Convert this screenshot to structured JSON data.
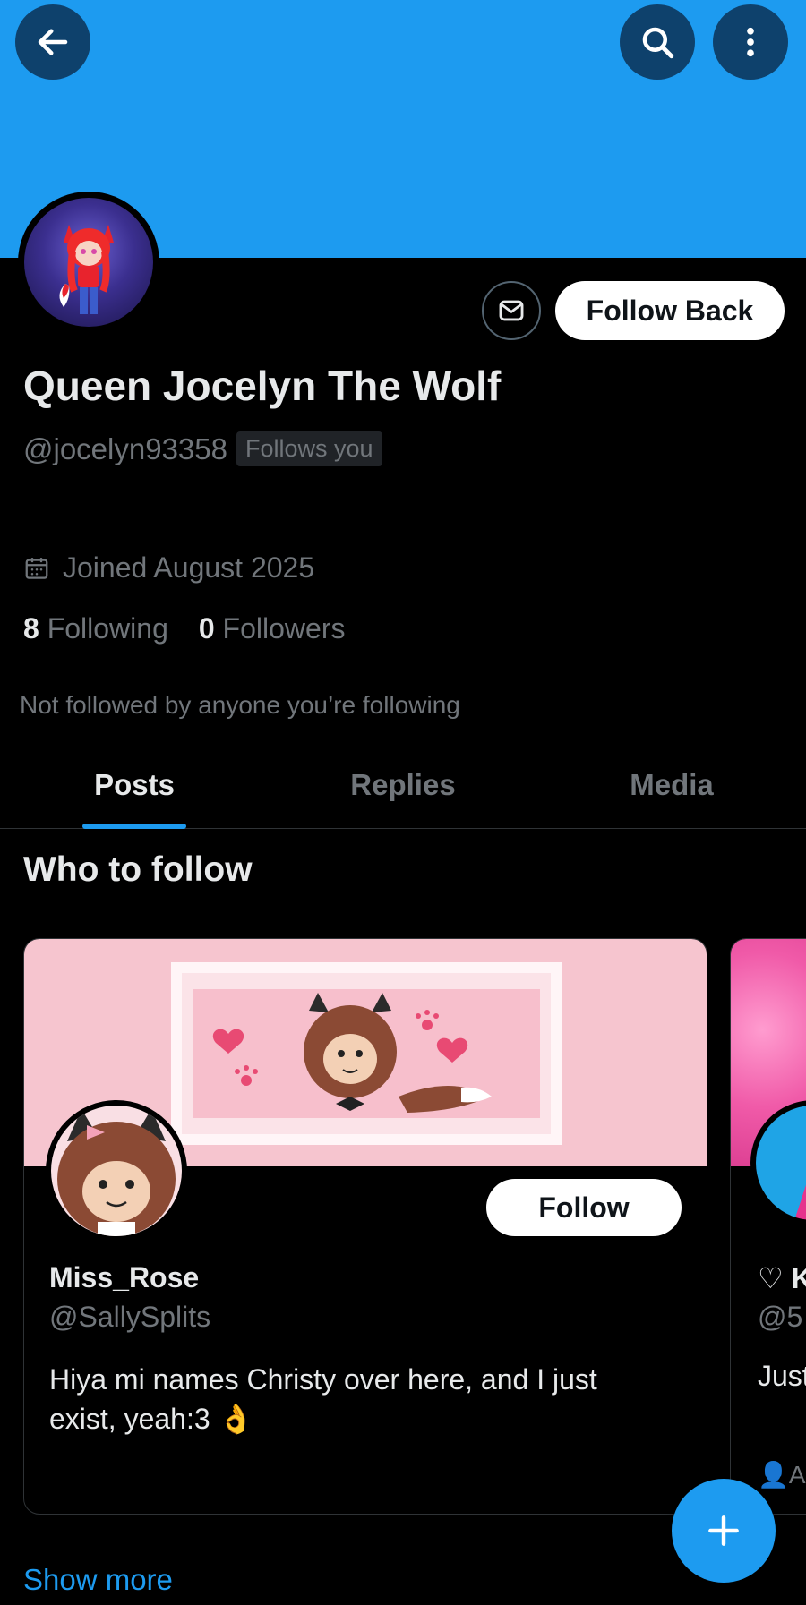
{
  "header": {
    "back_icon": "arrow-left-icon",
    "search_icon": "search-icon",
    "more_icon": "more-vertical-icon",
    "banner_color": "#1d9bf0"
  },
  "profile": {
    "name": "Queen Jocelyn The Wolf",
    "handle": "@jocelyn93358",
    "follows_you_label": "Follows you",
    "joined": "Joined August 2025",
    "following_count": "8",
    "following_label": "Following",
    "followers_count": "0",
    "followers_label": "Followers",
    "not_followed_text": "Not followed by anyone you’re following",
    "message_icon": "envelope-icon",
    "follow_back_label": "Follow Back"
  },
  "tabs": [
    {
      "label": "Posts",
      "active": true
    },
    {
      "label": "Replies",
      "active": false
    },
    {
      "label": "Media",
      "active": false
    }
  ],
  "who_to_follow": {
    "title": "Who to follow",
    "cards": [
      {
        "name": "Miss_Rose",
        "handle": "@SallySplits",
        "bio": "Hiya mi names Christy over here, and I just exist, yeah:3 👌",
        "follow_label": "Follow"
      },
      {
        "name": "♡ K",
        "handle": "@5",
        "bio": "Just",
        "footer": "Ar"
      }
    ],
    "show_more_label": "Show more"
  },
  "fab": {
    "icon": "plus-icon"
  },
  "colors": {
    "accent": "#1d9bf0",
    "background": "#000000",
    "muted_text": "#71767b"
  }
}
